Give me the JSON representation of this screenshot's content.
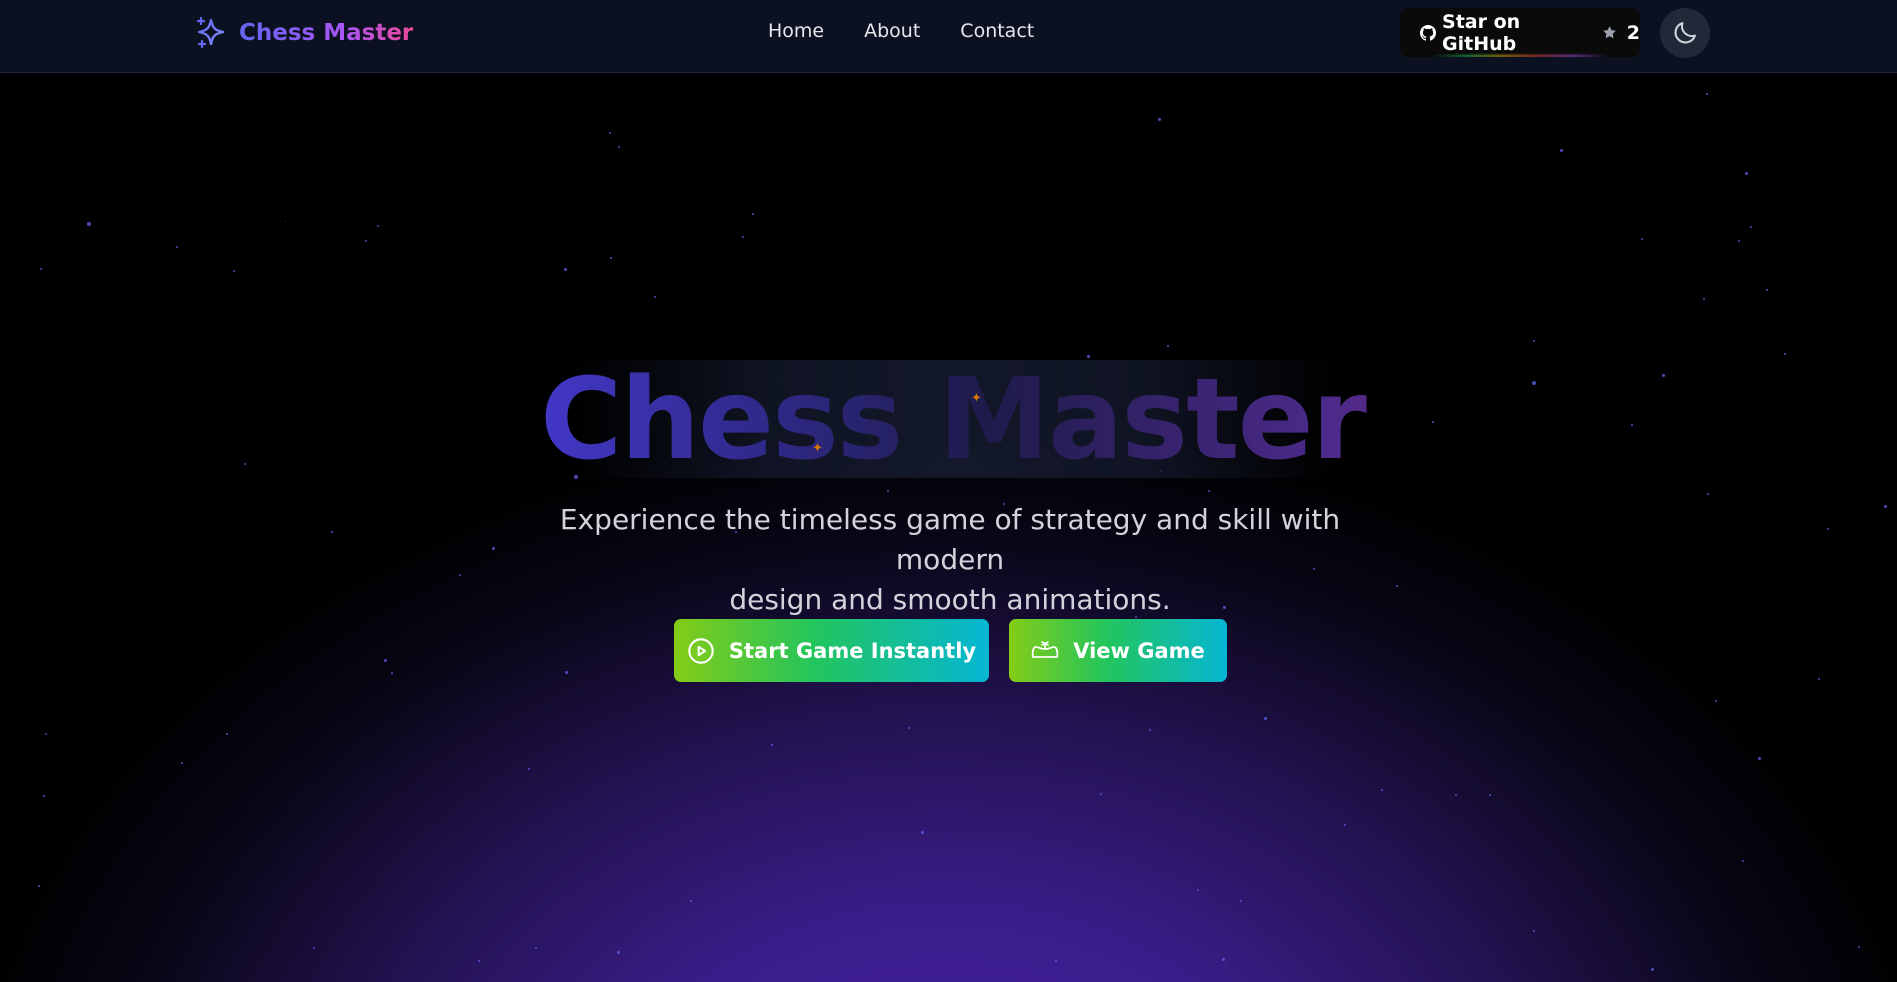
{
  "navbar": {
    "brand": "Chess Master",
    "brand_icon": "sparkles-icon",
    "links": [
      "Home",
      "About",
      "Contact"
    ],
    "github_label": "Star on GitHub",
    "github_stars": "2",
    "theme_toggle_icon": "moon-icon"
  },
  "hero": {
    "title": "Chess Master",
    "subtitle_line1": "Experience the timeless game of strategy and skill with modern",
    "subtitle_line2": "design and smooth animations.",
    "start_label": "Start Game Instantly",
    "start_icon": "play-circle-icon",
    "view_label": "View Game",
    "view_icon": "gamepad-icon"
  },
  "colors": {
    "brand_gradient": [
      "#6366f1",
      "#a855f7",
      "#ec4899"
    ],
    "cta_gradient": [
      "#84cc16",
      "#22c55e",
      "#06b6d4"
    ],
    "background_glow": "#4a24a8",
    "navbar_bg": "#0b1120"
  }
}
